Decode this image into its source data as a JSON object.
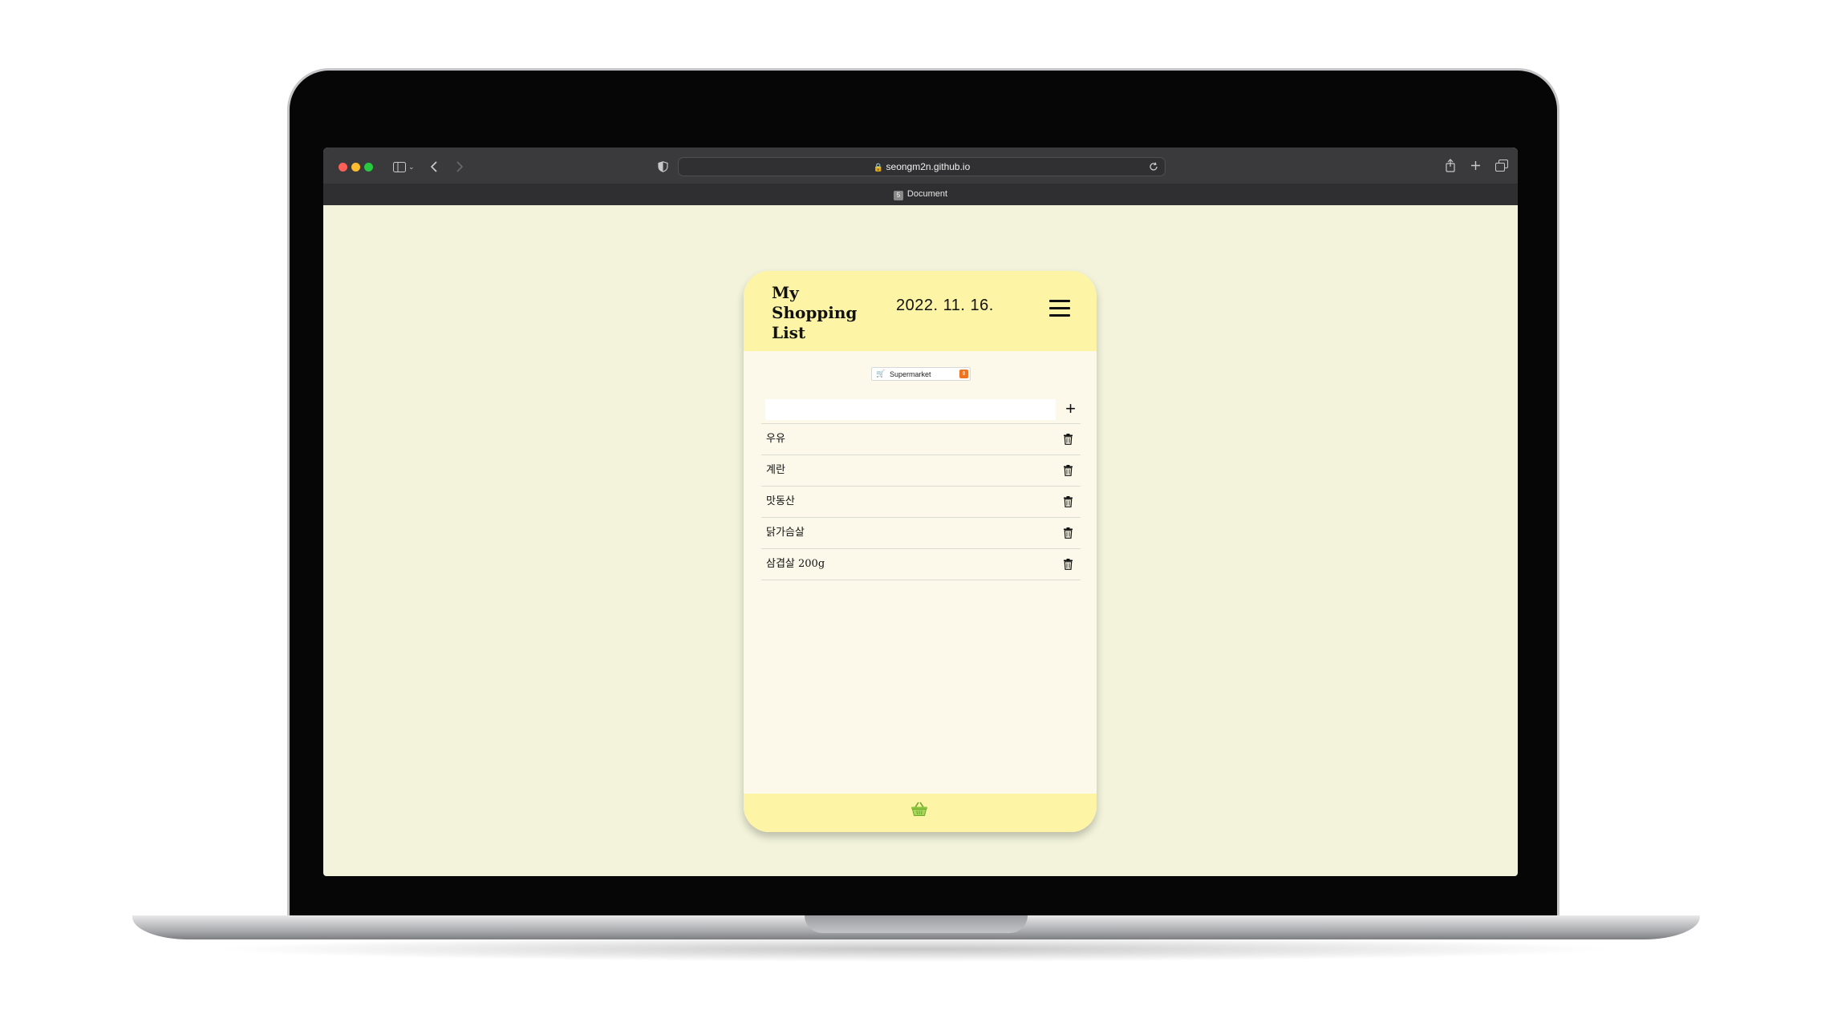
{
  "browser": {
    "url": "seongm2n.github.io",
    "tab_title": "Document",
    "tab_favicon": "5"
  },
  "app": {
    "title": "My Shopping List",
    "date": "2022. 11. 16.",
    "store": {
      "emoji": "🛒",
      "selected": "Supermarket"
    },
    "add": {
      "placeholder": "",
      "plus": "+"
    },
    "items": [
      {
        "name": "우유"
      },
      {
        "name": "계란"
      },
      {
        "name": "맛동산"
      },
      {
        "name": "닭가슴살"
      },
      {
        "name": "삼겹살 200g"
      }
    ]
  },
  "colors": {
    "page_background": "#f2f3da",
    "header_yellow": "#fdf5a5",
    "card_body": "#fdf9ea",
    "basket_green": "#8cc63f",
    "select_arrow": "#f0731f"
  },
  "icons": [
    "menu-icon",
    "trash-icon",
    "basket-icon",
    "plus-icon",
    "lock-icon",
    "reload-icon",
    "share-icon",
    "new-tab-icon",
    "tabs-overview-icon",
    "sidebar-icon",
    "back-icon",
    "forward-icon",
    "shield-icon"
  ]
}
